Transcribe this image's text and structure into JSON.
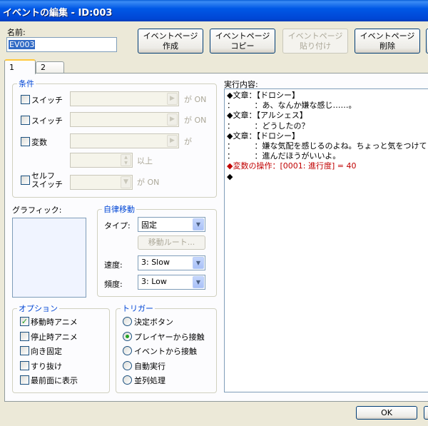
{
  "window": {
    "title": "イベントの編集 - ID:003"
  },
  "name": {
    "label": "名前:",
    "value": "EV003"
  },
  "toolbar": {
    "create": [
      "イベントページ",
      "作成"
    ],
    "copy": [
      "イベントページ",
      "コピー"
    ],
    "paste": [
      "イベントページ",
      "貼り付け"
    ],
    "delete": [
      "イベントページ",
      "削除"
    ]
  },
  "tabs": [
    "1",
    "2"
  ],
  "conditions": {
    "title": "条件",
    "switch1": {
      "label": "スイッチ",
      "suffix": "が ON"
    },
    "switch2": {
      "label": "スイッチ",
      "suffix": "が ON"
    },
    "variable": {
      "label": "変数",
      "suffix": "が",
      "suffix2": "以上"
    },
    "self_switch": {
      "label": [
        "セルフ",
        "スイッチ"
      ],
      "suffix": "が ON"
    }
  },
  "graphic": {
    "label": "グラフィック:"
  },
  "autonomous": {
    "title": "自律移動",
    "type_label": "タイプ:",
    "type_value": "固定",
    "route_button": "移動ルート...",
    "speed_label": "速度:",
    "speed_value": "3: Slow",
    "freq_label": "頻度:",
    "freq_value": "3: Low"
  },
  "options": {
    "title": "オプション",
    "items": [
      {
        "label": "移動時アニメ",
        "checked": true
      },
      {
        "label": "停止時アニメ",
        "checked": false
      },
      {
        "label": "向き固定",
        "checked": false
      },
      {
        "label": "すり抜け",
        "checked": false
      },
      {
        "label": "最前面に表示",
        "checked": false
      }
    ]
  },
  "trigger": {
    "title": "トリガー",
    "items": [
      {
        "label": "決定ボタン",
        "selected": false
      },
      {
        "label": "プレイヤーから接触",
        "selected": true
      },
      {
        "label": "イベントから接触",
        "selected": false
      },
      {
        "label": "自動実行",
        "selected": false
      },
      {
        "label": "並列処理",
        "selected": false
      }
    ]
  },
  "contents": {
    "label": "実行内容:",
    "lines": [
      {
        "text": "◆文章：【ドロシー】",
        "red": false
      },
      {
        "text": "：　　　：あ、なんか嫌な感じ……。",
        "red": false
      },
      {
        "text": "◆文章：【アルシェス】",
        "red": false
      },
      {
        "text": "：　　　：どうしたの？",
        "red": false
      },
      {
        "text": "◆文章：【ドロシー】",
        "red": false
      },
      {
        "text": "：　　　：嫌な気配を感じるのよね。ちょっと気をつけて",
        "red": false
      },
      {
        "text": "：　　　：進んだほうがいいよ。",
        "red": false
      },
      {
        "text": "◆変数の操作：[0001: 進行度] = 40",
        "red": true
      },
      {
        "text": "◆",
        "red": false
      }
    ]
  },
  "footer": {
    "ok": "OK"
  },
  "colors": {
    "titlebar": "#0058e6",
    "accent_blue": "#0046d5",
    "command_red": "#c00000",
    "check_green": "#21a121"
  }
}
